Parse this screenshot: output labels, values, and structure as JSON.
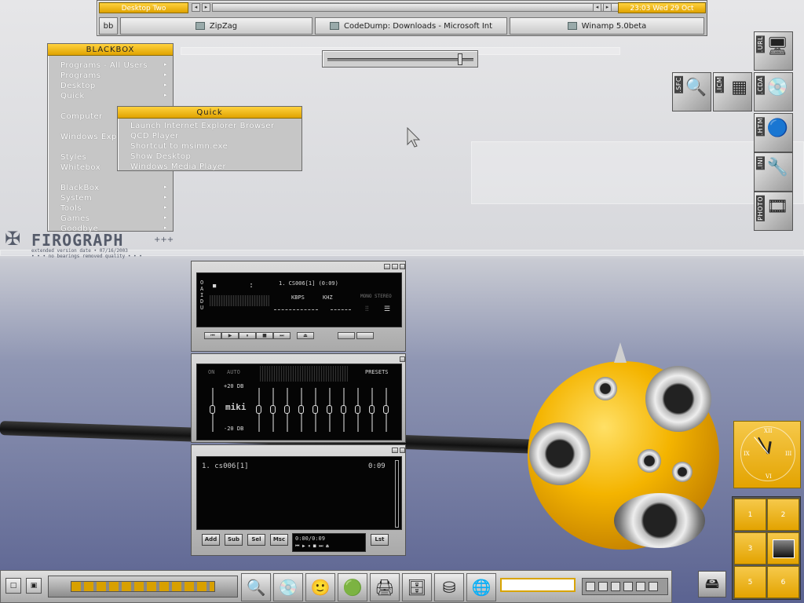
{
  "topbar": {
    "workspace": "Desktop Two",
    "clock": "23:03 Wed 29 Oct",
    "toggle": "bb",
    "tasks": [
      {
        "label": "ZipZag",
        "icon": "folder-icon"
      },
      {
        "label": "CodeDump: Downloads - Microsoft Int",
        "icon": "ie-icon"
      },
      {
        "label": "Winamp 5.0beta",
        "icon": "winamp-icon"
      }
    ]
  },
  "volume_slider": {
    "level": 0.92
  },
  "blackbox_menu": {
    "title": "BLACKBOX",
    "items": [
      {
        "label": "Programs - All Users",
        "submenu": true
      },
      {
        "label": "Programs",
        "submenu": true
      },
      {
        "label": "Desktop",
        "submenu": true
      },
      {
        "label": "Quick",
        "submenu": true
      },
      {
        "label": "Computer",
        "submenu": false
      },
      {
        "label": "Windows Exp",
        "submenu": false
      },
      {
        "label": "Styles",
        "submenu": false
      },
      {
        "label": "Whitebox",
        "submenu": false
      },
      {
        "label": "BlackBox",
        "submenu": true
      },
      {
        "label": "System",
        "submenu": true
      },
      {
        "label": "Tools",
        "submenu": true
      },
      {
        "label": "Games",
        "submenu": true
      },
      {
        "label": "Goodbye",
        "submenu": true
      }
    ]
  },
  "quick_menu": {
    "title": "Quick",
    "items": [
      "Launch Internet Explorer Browser",
      "QCD Player",
      "Shortcut to msimn.exe",
      "Show Desktop",
      "Windows Media Player"
    ]
  },
  "desktop_icons": [
    {
      "label": ".URL",
      "icon": "network-computer-icon"
    },
    {
      "label": ".SFC",
      "icon": "magnifier-icon"
    },
    {
      "label": ".ICM",
      "icon": "color-grid-icon"
    },
    {
      "label": ".CDA",
      "icon": "cd-icon"
    },
    {
      "label": ".HTM",
      "icon": "globe-pin-icon"
    },
    {
      "label": ".INI",
      "icon": "wrench-icon"
    },
    {
      "label": "PHOTO",
      "icon": "film-icon"
    }
  ],
  "wallpaper": {
    "logo": "FIROGRAPH",
    "logo_sub": "extended version date • 07/16/2003",
    "logo_sub2": "• • • no bearings removed quality • • •",
    "plus": "+++"
  },
  "winamp": {
    "side_label": "OAIDU",
    "time": ":",
    "track": "1. CS006[1] (0:09)",
    "kbps": "KBPS",
    "khz": "KHZ",
    "mono_stereo": "MONO STEREO",
    "eq": {
      "on": "ON",
      "auto": "AUTO",
      "presets": "PRESETS",
      "plus_db": "+20 DB",
      "minus_db": "-20 DB",
      "logo": "miki",
      "bands": [
        0.5,
        0.5,
        0.5,
        0.5,
        0.5,
        0.5,
        0.5,
        0.5,
        0.5,
        0.5
      ]
    },
    "playlist": {
      "entry": "1. cs006[1]",
      "duration": "0:09",
      "time_display": "0:00/0:09",
      "buttons": [
        "Add",
        "Sub",
        "Sel",
        "Msc",
        "Lst"
      ]
    }
  },
  "clock_widget": {
    "numerals": [
      "XII",
      "III",
      "VI",
      "IX"
    ]
  },
  "pager": {
    "workspaces": [
      "1",
      "2",
      "3",
      "",
      "5",
      "6"
    ]
  },
  "colors": {
    "accent": "#e9ab00",
    "accent_light": "#ffd23f"
  }
}
